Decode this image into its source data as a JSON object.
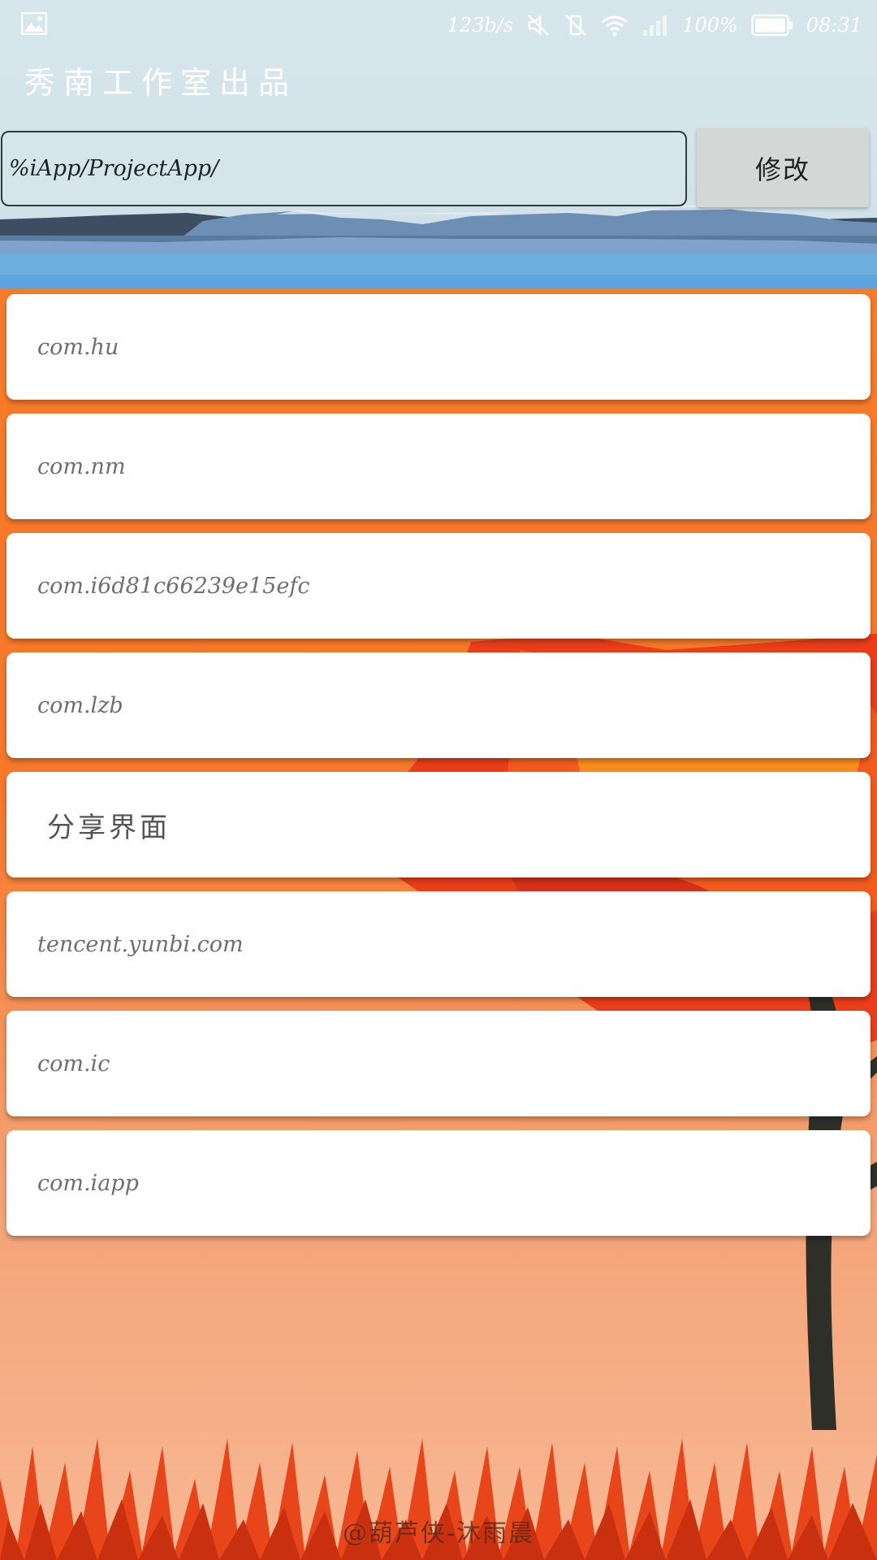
{
  "status_bar": {
    "network_speed": "123b/s",
    "battery_percent": "100%",
    "time": "08:31",
    "icons": [
      "image-icon",
      "mute-icon",
      "vibrate-off-icon",
      "wifi-icon",
      "signal-icon",
      "battery-icon"
    ]
  },
  "header": {
    "title": "秀南工作室出品"
  },
  "path_bar": {
    "input_value": "%iApp/ProjectApp/",
    "button_label": "修改"
  },
  "list": {
    "items": [
      {
        "label": "com.hu"
      },
      {
        "label": "com.nm"
      },
      {
        "label": "com.i6d81c66239e15efc"
      },
      {
        "label": "com.lzb"
      },
      {
        "label": "分享界面"
      },
      {
        "label": "tencent.yunbi.com"
      },
      {
        "label": "com.ic"
      },
      {
        "label": "com.iapp"
      }
    ]
  },
  "footer": {
    "credit": "@葫芦侠-沐雨晨"
  },
  "colors": {
    "sky": "#d6e6ec",
    "accent_orange": "#f77a28",
    "card": "#ffffff"
  }
}
